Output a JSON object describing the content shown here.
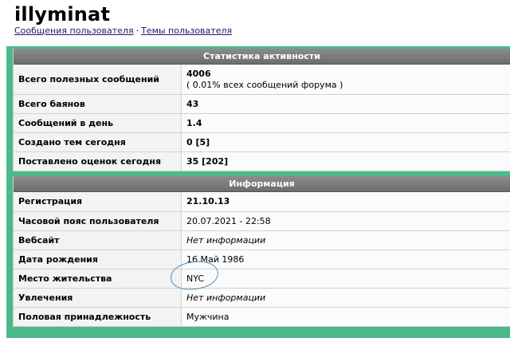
{
  "profile": {
    "username": "illyminat",
    "links": {
      "posts": "Сообщения пользователя",
      "separator": "·",
      "topics": "Темы пользователя"
    }
  },
  "stats": {
    "header": "Статистика активности",
    "rows": [
      {
        "label": "Всего полезных сообщений",
        "value": "4006",
        "sub": "( 0.01% всех сообщений форума )"
      },
      {
        "label": "Всего баянов",
        "value": "43"
      },
      {
        "label": "Сообщений в день",
        "value": "1.4"
      },
      {
        "label": "Создано тем сегодня",
        "value": "0 [5]"
      },
      {
        "label": "Поставлено оценок сегодня",
        "value": "35 [202]"
      }
    ]
  },
  "info": {
    "header": "Информация",
    "rows": [
      {
        "label": "Регистрация",
        "value": "21.10.13"
      },
      {
        "label": "Часовой пояс пользователя",
        "value": "20.07.2021 - 22:58"
      },
      {
        "label": "Вебсайт",
        "value": "Нет информации"
      },
      {
        "label": "Дата рождения",
        "value": "16 Май 1986"
      },
      {
        "label": "Место жительства",
        "value": "NYC"
      },
      {
        "label": "Увлечения",
        "value": "Нет информации"
      },
      {
        "label": "Половая принадлежность",
        "value": "Мужчина"
      }
    ]
  },
  "colors": {
    "accent_background": "#4db88a",
    "header_background": "#7a7a7a",
    "annotation_circle": "#4a8fb7"
  }
}
